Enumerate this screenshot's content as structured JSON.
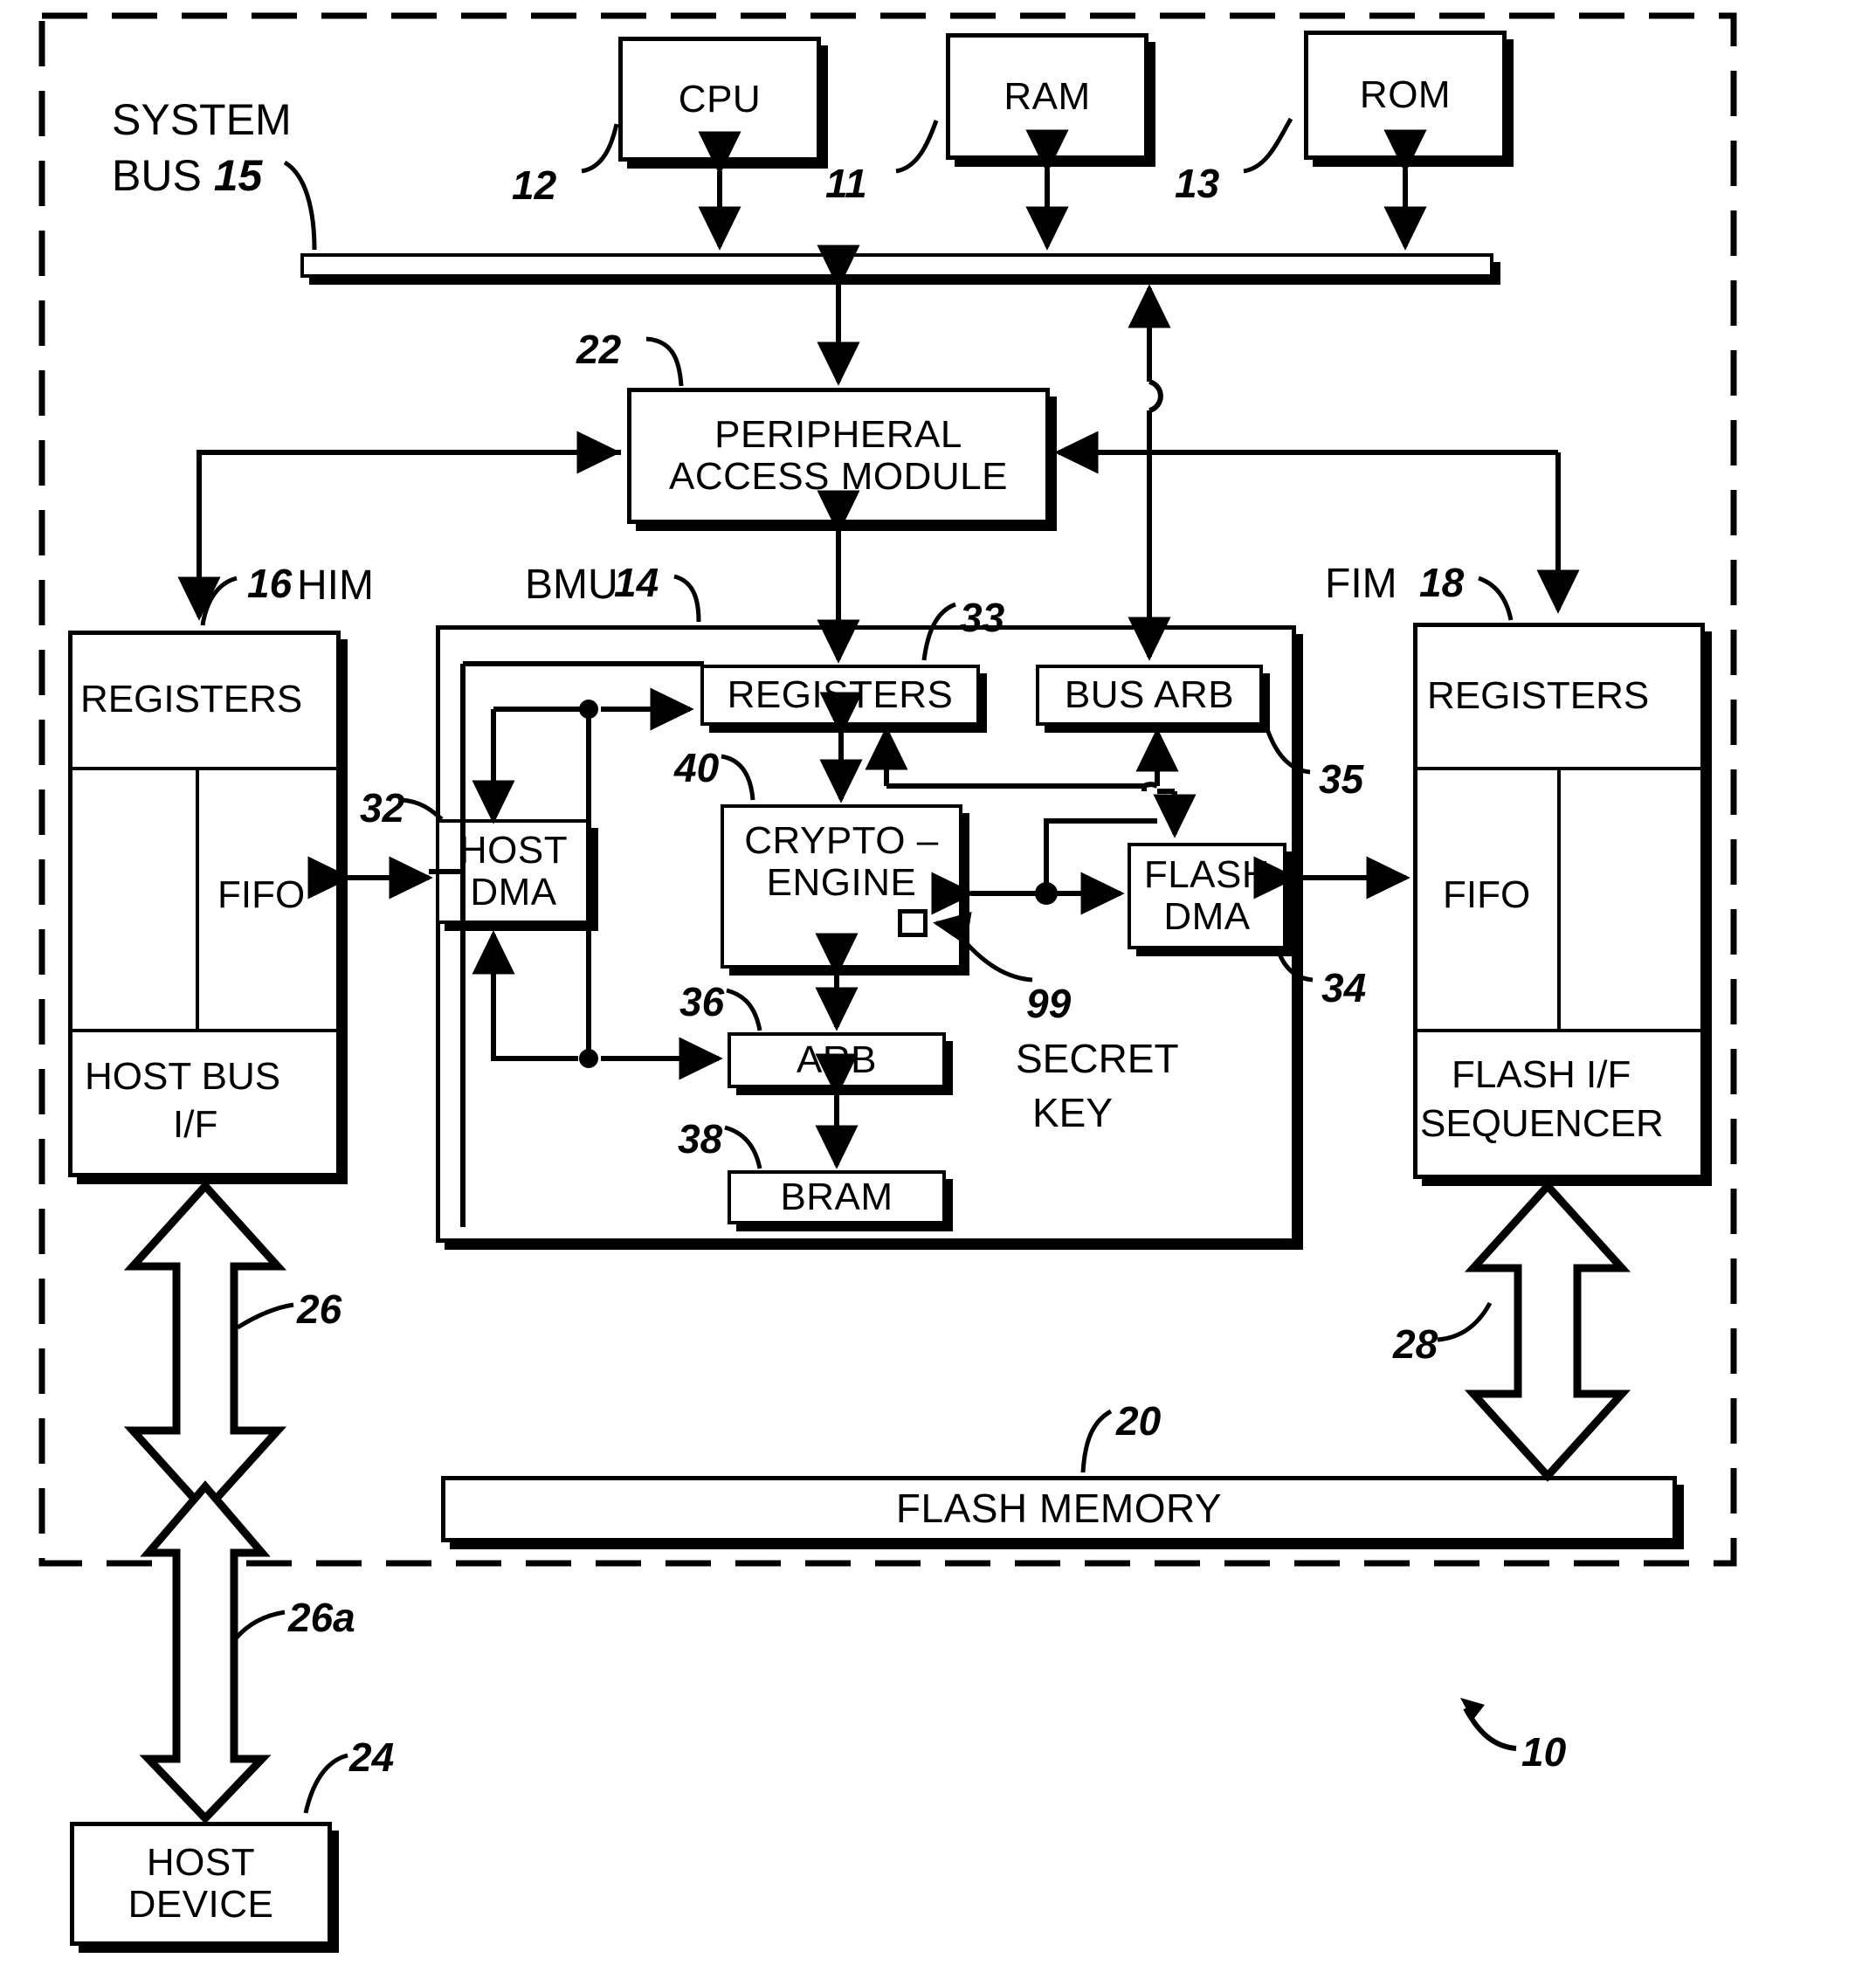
{
  "figure": {
    "reference_numeral": "10",
    "outer_boundary": "dashed-card-boundary"
  },
  "top_blocks": [
    {
      "label": "CPU",
      "numeral": "12"
    },
    {
      "label": "RAM",
      "numeral": "11"
    },
    {
      "label": "ROM",
      "numeral": "13"
    }
  ],
  "system_bus": {
    "label": "SYSTEM\nBUS",
    "numeral": "15",
    "label_line1": "SYSTEM",
    "label_line2": "BUS 15"
  },
  "peripheral_access_module": {
    "line1": "PERIPHERAL",
    "line2": "ACCESS MODULE",
    "numeral": "22"
  },
  "him": {
    "title": "HIM",
    "numeral": "16",
    "sections": [
      {
        "label": "REGISTERS"
      },
      {
        "label": "FIFO"
      },
      {
        "label": "HOST BUS",
        "label2": "I/F"
      }
    ]
  },
  "fim": {
    "title": "FIM",
    "numeral": "18",
    "sections": [
      {
        "label": "REGISTERS"
      },
      {
        "label": "FIFO"
      },
      {
        "label": "FLASH I/F",
        "label2": "SEQUENCER"
      }
    ]
  },
  "bmu": {
    "title": "BMU",
    "numeral": "14",
    "blocks": [
      {
        "label": "REGISTERS",
        "numeral": "33",
        "name": "bmu-registers"
      },
      {
        "label": "BUS ARB",
        "numeral": "35",
        "name": "bus-arb"
      },
      {
        "label": "HOST DMA",
        "line1": "HOST",
        "line2": "DMA",
        "numeral": "32",
        "name": "host-dma"
      },
      {
        "label": "CRYPTO-ENGINE",
        "line1": "CRYPTO –",
        "line2": "ENGINE",
        "numeral": "40",
        "name": "crypto-engine"
      },
      {
        "label": "FLASH DMA",
        "line1": "FLASH",
        "line2": "DMA",
        "numeral": "34",
        "name": "flash-dma"
      },
      {
        "label": "ARB",
        "numeral": "36",
        "name": "arb"
      },
      {
        "label": "BRAM",
        "numeral": "38",
        "name": "bram"
      }
    ],
    "secret_key": {
      "numeral": "99",
      "line1": "SECRET",
      "line2": "KEY"
    }
  },
  "host_interface": {
    "label": "HOST I/F",
    "numeral": "26"
  },
  "host_interface_lower": {
    "numeral": "26a"
  },
  "host_device": {
    "line1": "HOST",
    "line2": "DEVICE",
    "numeral": "24"
  },
  "flash_interface": {
    "label": "FLASH I/F",
    "numeral": "28"
  },
  "flash_memory": {
    "label": "FLASH MEMORY",
    "numeral": "20"
  },
  "colors": {
    "stroke": "#000000",
    "background": "#ffffff"
  }
}
